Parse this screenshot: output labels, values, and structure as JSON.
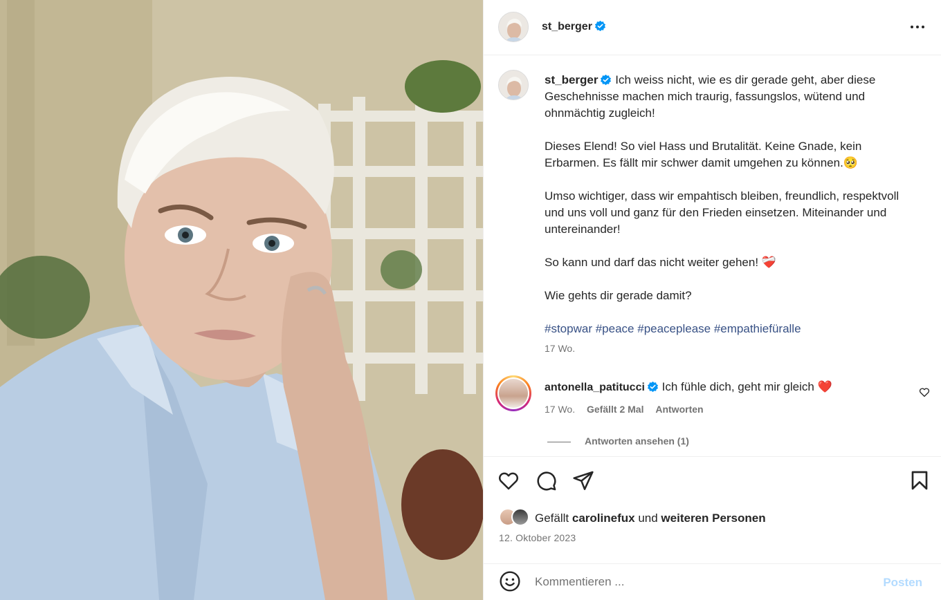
{
  "post": {
    "username": "st_berger",
    "verified": true,
    "more_icon": "more-horizontal-icon"
  },
  "caption": {
    "username": "st_berger",
    "paragraph1": "Ich weiss nicht, wie es dir gerade geht, aber diese Geschehnisse machen mich traurig, fassungslos, wütend und ohnmächtig zugleich!",
    "paragraph2": "Dieses Elend! So viel Hass und Brutalität. Keine Gnade, kein Erbarmen. Es fällt mir schwer damit umgehen zu können.🥺",
    "paragraph3": "Umso wichtiger, dass wir empahtisch bleiben, freundlich, respektvoll und uns voll und ganz für den Frieden einsetzen. Miteinander und untereinander!",
    "paragraph4": "So kann und darf das nicht weiter gehen! ❤️‍🩹",
    "paragraph5": "Wie gehts dir gerade damit?",
    "hashtags": [
      "#stopwar",
      "#peace",
      "#peaceplease",
      "#empathiefüralle"
    ],
    "time": "17 Wo."
  },
  "comment": {
    "username": "antonella_patitucci",
    "verified": true,
    "text": "Ich fühle dich, geht mir gleich ❤️",
    "time": "17 Wo.",
    "likes_label": "Gefällt 2 Mal",
    "reply_label": "Antworten",
    "view_replies": "Antworten ansehen (1)"
  },
  "actions": {
    "icons": [
      "heart-icon",
      "comment-icon",
      "share-icon",
      "bookmark-icon"
    ]
  },
  "likes": {
    "prefix": "Gefällt",
    "user": "carolinefux",
    "connector": "und",
    "suffix": "weiteren Personen"
  },
  "date": "12. Oktober 2023",
  "composer": {
    "placeholder": "Kommentieren ...",
    "post_label": "Posten"
  },
  "colors": {
    "link": "#385185",
    "verified": "#0095f6",
    "post_disabled": "#b3dbff",
    "meta_text": "#737373"
  }
}
